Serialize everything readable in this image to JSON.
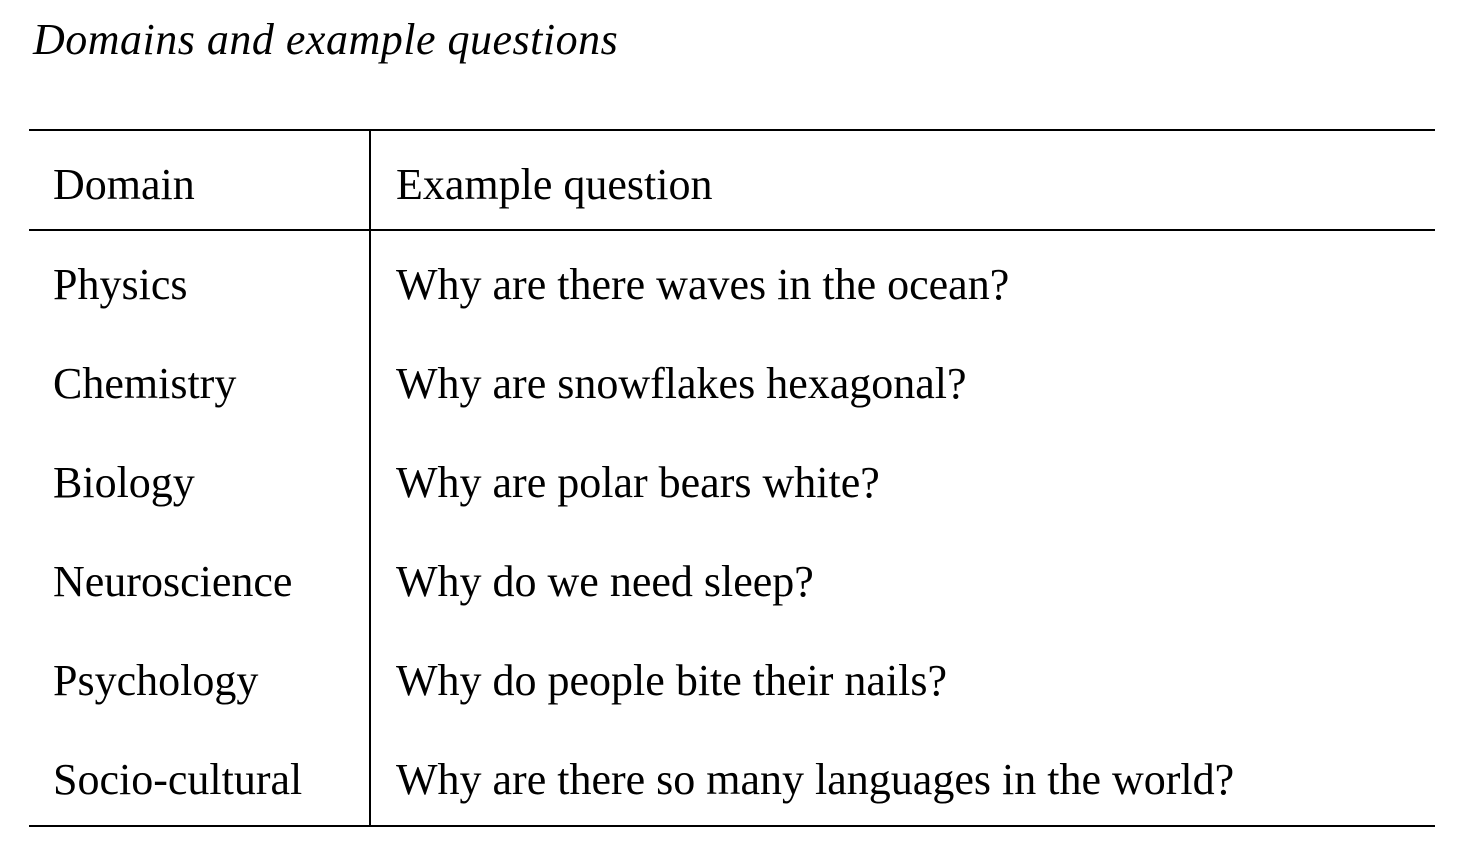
{
  "caption": "Domains and example questions",
  "table": {
    "headers": [
      "Domain",
      "Example question"
    ],
    "rows": [
      [
        "Physics",
        "Why are there waves in the ocean?"
      ],
      [
        "Chemistry",
        "Why are snowflakes hexagonal?"
      ],
      [
        "Biology",
        "Why are polar bears white?"
      ],
      [
        "Neuroscience",
        "Why do we need sleep?"
      ],
      [
        "Psychology",
        "Why do people bite their nails?"
      ],
      [
        "Socio-cultural",
        "Why are there so many languages in the world?"
      ]
    ]
  }
}
